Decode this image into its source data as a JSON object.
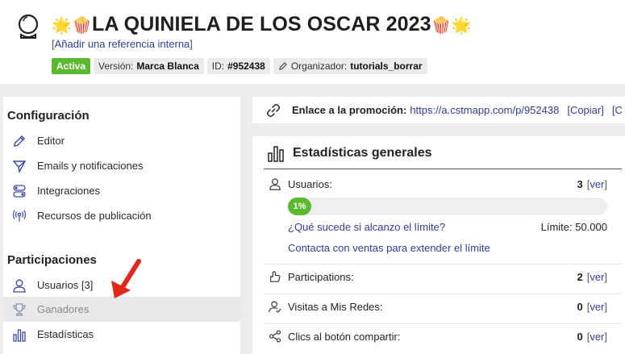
{
  "header": {
    "title": "LA QUINIELA DE LOS OSCAR 2023",
    "title_emoji_left": "🌟🍿",
    "title_emoji_right": "🍿🌟",
    "internal_ref_link": "Añadir una referencia interna",
    "status_badge": "Activa",
    "version_label": "Versión:",
    "version_value": "Marca Blanca",
    "id_label": "ID:",
    "id_value": "#952438",
    "organizer_label": "Organizador:",
    "organizer_value": "tutorials_borrar"
  },
  "sidebar": {
    "config_title": "Configuración",
    "config_items": [
      {
        "label": "Editor",
        "icon": "pencil-icon"
      },
      {
        "label": "Emails y notificaciones",
        "icon": "send-icon"
      },
      {
        "label": "Integraciones",
        "icon": "toggles-icon"
      },
      {
        "label": "Recursos de publicación",
        "icon": "broadcast-icon"
      }
    ],
    "participations_title": "Participaciones",
    "participation_items": [
      {
        "label": "Usuarios [3]",
        "icon": "user-icon"
      },
      {
        "label": "Ganadores",
        "icon": "trophy-icon"
      },
      {
        "label": "Estadísticas",
        "icon": "bar-chart-icon"
      }
    ]
  },
  "promo_link": {
    "label": "Enlace a la promoción:",
    "url": "https://a.cstmapp.com/p/952438",
    "copy": "[Copiar]",
    "truncated": "[C"
  },
  "stats": {
    "title": "Estadísticas generales",
    "users": {
      "label": "Usuarios:",
      "value": "3",
      "link": "ver"
    },
    "progress": {
      "text": "1%",
      "percent": 1
    },
    "faq_link": "¿Qué sucede si alcanzo el límite?",
    "limit_text": "Límite: 50.000",
    "contact_link": "Contacta con ventas para extender el límite",
    "participations": {
      "label": "Participations:",
      "value": "2",
      "link": "ver"
    },
    "visits": {
      "label": "Visitas a Mis Redes:",
      "value": "0",
      "link": "ver"
    },
    "shares": {
      "label": "Clics al botón compartir:",
      "value": "0",
      "link": "ver"
    }
  },
  "colors": {
    "accent_green": "#5cb82f",
    "link_blue": "#2f3d9c",
    "icon_blue": "#3a4aa8",
    "arrow_red": "#e3261a"
  }
}
